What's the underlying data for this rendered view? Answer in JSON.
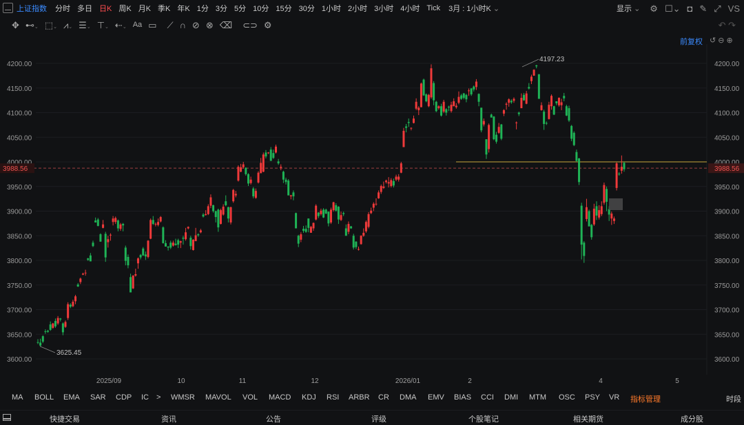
{
  "index_name": "上证指数",
  "periods": [
    "分时",
    "多日",
    "日K",
    "周K",
    "月K",
    "季K",
    "年K",
    "1分",
    "3分",
    "5分",
    "10分",
    "15分",
    "30分",
    "1小时",
    "2小时",
    "3小时",
    "4小时",
    "Tick"
  ],
  "active_period": "日K",
  "custom_period": "3月 : 1小时K",
  "display_menu": "显示",
  "vs_label": "VS",
  "adjust_label": "前复权",
  "toolbar_icons": [
    "move-icon",
    "line-tool-icon",
    "rect-tool-icon",
    "pattern-tool-icon",
    "fibonacci-tool-icon",
    "vertical-line-icon",
    "arrow-tool-icon",
    "text-tool-icon",
    "comment-tool-icon",
    "brush-icon",
    "magnet-icon",
    "hide-drawings-icon",
    "trash-icon",
    "link-icon",
    "settings-icon"
  ],
  "colors": {
    "up": "#ef3a3a",
    "down": "#1fb356",
    "accent": "#3b8bff",
    "highlight": "#ff7a2a",
    "hline": "#c8a83b",
    "price_tag": "#ef5350"
  },
  "chart_data": {
    "type": "candlestick",
    "title": "",
    "xlabel": "",
    "ylabel": "",
    "ylim": [
      3570,
      4240
    ],
    "y_ticks": [
      "4200.00",
      "4150.00",
      "4100.00",
      "4050.00",
      "4000.00",
      "3950.00",
      "3900.00",
      "3850.00",
      "3800.00",
      "3750.00",
      "3700.00",
      "3650.00",
      "3600.00"
    ],
    "x_ticks": [
      "2025/09",
      "10",
      "11",
      "12",
      "2026/01",
      "2",
      "3",
      "4",
      "5"
    ],
    "current_price": "3988.56",
    "horizontal_line": 4000,
    "annotations": [
      {
        "label": "4197.23",
        "type": "high"
      },
      {
        "label": "3625.45",
        "type": "low"
      }
    ],
    "candles": [
      [
        3634,
        3633,
        3630,
        3640
      ],
      [
        3633,
        3627,
        3625,
        3641
      ],
      [
        3646,
        3635,
        3632,
        3648
      ],
      [
        3656,
        3655,
        3651,
        3660
      ],
      [
        3657,
        3655,
        3653,
        3659
      ],
      [
        3670,
        3659,
        3657,
        3676
      ],
      [
        3663,
        3672,
        3661,
        3673
      ],
      [
        3677,
        3666,
        3663,
        3682
      ],
      [
        3672,
        3683,
        3669,
        3687
      ],
      [
        3682,
        3680,
        3676,
        3683
      ],
      [
        3672,
        3654,
        3648,
        3674
      ],
      [
        3665,
        3675,
        3663,
        3678
      ],
      [
        3683,
        3711,
        3679,
        3715
      ],
      [
        3710,
        3706,
        3703,
        3713
      ],
      [
        3707,
        3716,
        3705,
        3720
      ],
      [
        3717,
        3727,
        3711,
        3730
      ],
      [
        3751,
        3747,
        3746,
        3754
      ],
      [
        3756,
        3763,
        3752,
        3765
      ],
      [
        3771,
        3773,
        3770,
        3775
      ],
      [
        3774,
        3775,
        3769,
        3781
      ],
      [
        3804,
        3801,
        3799,
        3805
      ],
      [
        3810,
        3798,
        3798,
        3815
      ],
      [
        3836,
        3829,
        3827,
        3840
      ],
      [
        3881,
        3877,
        3877,
        3887
      ],
      [
        3883,
        3870,
        3869,
        3886
      ],
      [
        3853,
        3838,
        3838,
        3855
      ],
      [
        3866,
        3873,
        3865,
        3882
      ],
      [
        3854,
        3806,
        3797,
        3858
      ],
      [
        3837,
        3843,
        3826,
        3850
      ],
      [
        3852,
        3852,
        3840,
        3855
      ],
      [
        3878,
        3885,
        3871,
        3890
      ],
      [
        3878,
        3886,
        3874,
        3889
      ],
      [
        3881,
        3865,
        3859,
        3883
      ],
      [
        3864,
        3873,
        3860,
        3876
      ],
      [
        3874,
        3871,
        3859,
        3876
      ],
      [
        3826,
        3799,
        3790,
        3830
      ],
      [
        3807,
        3790,
        3784,
        3812
      ],
      [
        3766,
        3735,
        3735,
        3773
      ],
      [
        3743,
        3769,
        3742,
        3770
      ],
      [
        3769,
        3772,
        3767,
        3783
      ],
      [
        3794,
        3804,
        3783,
        3806
      ],
      [
        3811,
        3806,
        3802,
        3813
      ],
      [
        3824,
        3810,
        3809,
        3827
      ],
      [
        3812,
        3808,
        3801,
        3818
      ],
      [
        3807,
        3840,
        3804,
        3841
      ],
      [
        3844,
        3882,
        3843,
        3885
      ],
      [
        3882,
        3874,
        3872,
        3890
      ],
      [
        3874,
        3874,
        3869,
        3877
      ],
      [
        3872,
        3878,
        3869,
        3885
      ],
      [
        3879,
        3888,
        3877,
        3890
      ],
      [
        3867,
        3835,
        3834,
        3869
      ],
      [
        3835,
        3828,
        3828,
        3841
      ],
      [
        3828,
        3826,
        3820,
        3829
      ],
      [
        3836,
        3826,
        3823,
        3840
      ],
      [
        3830,
        3836,
        3828,
        3840
      ],
      [
        3834,
        3831,
        3830,
        3844
      ],
      [
        3841,
        3832,
        3825,
        3844
      ],
      [
        3836,
        3839,
        3825,
        3840
      ],
      [
        3846,
        3844,
        3832,
        3850
      ],
      [
        3843,
        3857,
        3840,
        3866
      ],
      [
        3865,
        3868,
        3863,
        3869
      ],
      [
        3846,
        3829,
        3822,
        3850
      ],
      [
        3821,
        3842,
        3820,
        3843
      ],
      [
        3839,
        3851,
        3839,
        3866
      ],
      [
        3853,
        3851,
        3848,
        3855
      ],
      [
        3857,
        3861,
        3855,
        3864
      ],
      [
        3893,
        3889,
        3887,
        3896
      ],
      [
        3892,
        3894,
        3891,
        3902
      ],
      [
        3894,
        3910,
        3892,
        3914
      ],
      [
        3911,
        3928,
        3906,
        3934
      ],
      [
        3912,
        3900,
        3897,
        3913
      ],
      [
        3900,
        3888,
        3877,
        3901
      ],
      [
        3903,
        3867,
        3858,
        3905
      ],
      [
        3874,
        3902,
        3873,
        3905
      ],
      [
        3893,
        3909,
        3891,
        3914
      ],
      [
        3920,
        3912,
        3910,
        3932
      ],
      [
        3908,
        3885,
        3877,
        3909
      ],
      [
        3877,
        3908,
        3873,
        3909
      ],
      [
        3920,
        3943,
        3917,
        3945
      ],
      [
        3932,
        3935,
        3928,
        3941
      ],
      [
        3962,
        3990,
        3960,
        3993
      ],
      [
        3980,
        3989,
        3979,
        3996
      ],
      [
        3989,
        3995,
        3986,
        4000
      ],
      [
        3988,
        3975,
        3972,
        3989
      ],
      [
        3975,
        3956,
        3951,
        3977
      ],
      [
        3957,
        3964,
        3954,
        3970
      ],
      [
        3946,
        3930,
        3926,
        3949
      ],
      [
        3927,
        3941,
        3925,
        3946
      ],
      [
        3958,
        3978,
        3956,
        3981
      ],
      [
        3977,
        3998,
        3977,
        4008
      ],
      [
        3980,
        4015,
        3979,
        4019
      ],
      [
        4019,
        4011,
        4007,
        4024
      ],
      [
        4019,
        4019,
        4016,
        4020
      ],
      [
        4025,
        4002,
        4002,
        4030
      ],
      [
        4018,
        4008,
        4006,
        4025
      ],
      [
        4019,
        4031,
        4017,
        4035
      ],
      [
        4001,
        3997,
        3994,
        4006
      ],
      [
        3988,
        3990,
        3983,
        3995
      ],
      [
        3980,
        3964,
        3957,
        3982
      ],
      [
        3964,
        3959,
        3954,
        3968
      ],
      [
        3962,
        3932,
        3932,
        3965
      ],
      [
        3930,
        3932,
        3924,
        3933
      ],
      [
        3938,
        3930,
        3922,
        3942
      ],
      [
        3896,
        3865,
        3865,
        3897
      ],
      [
        3850,
        3834,
        3827,
        3852
      ],
      [
        3842,
        3853,
        3837,
        3857
      ],
      [
        3864,
        3860,
        3856,
        3870
      ],
      [
        3864,
        3858,
        3856,
        3871
      ],
      [
        3885,
        3866,
        3857,
        3885
      ],
      [
        3856,
        3868,
        3857,
        3870
      ],
      [
        3865,
        3876,
        3860,
        3877
      ],
      [
        3883,
        3911,
        3881,
        3914
      ],
      [
        3897,
        3890,
        3886,
        3898
      ],
      [
        3894,
        3901,
        3891,
        3905
      ],
      [
        3903,
        3887,
        3886,
        3906
      ],
      [
        3903,
        3895,
        3894,
        3905
      ],
      [
        3899,
        3875,
        3869,
        3899
      ],
      [
        3877,
        3903,
        3874,
        3907
      ],
      [
        3902,
        3918,
        3899,
        3919
      ],
      [
        3912,
        3901,
        3899,
        3916
      ],
      [
        3909,
        3883,
        3874,
        3910
      ],
      [
        3882,
        3892,
        3880,
        3899
      ],
      [
        3896,
        3894,
        3890,
        3899
      ],
      [
        3865,
        3850,
        3850,
        3873
      ],
      [
        3858,
        3874,
        3853,
        3879
      ],
      [
        3869,
        3865,
        3864,
        3870
      ],
      [
        3850,
        3826,
        3822,
        3854
      ],
      [
        3838,
        3827,
        3823,
        3839
      ],
      [
        3822,
        3823,
        3820,
        3828
      ],
      [
        3833,
        3850,
        3832,
        3851
      ],
      [
        3850,
        3856,
        3848,
        3865
      ],
      [
        3859,
        3878,
        3856,
        3881
      ],
      [
        3868,
        3894,
        3865,
        3898
      ],
      [
        3896,
        3901,
        3894,
        3907
      ],
      [
        3907,
        3915,
        3900,
        3918
      ],
      [
        3915,
        3915,
        3911,
        3926
      ],
      [
        3926,
        3938,
        3925,
        3942
      ],
      [
        3939,
        3951,
        3935,
        3954
      ],
      [
        3947,
        3950,
        3945,
        3960
      ],
      [
        3959,
        3962,
        3956,
        3964
      ],
      [
        3956,
        3959,
        3948,
        3969
      ],
      [
        3951,
        3963,
        3948,
        3967
      ],
      [
        3961,
        3952,
        3948,
        3966
      ],
      [
        3964,
        3970,
        3961,
        3974
      ],
      [
        3964,
        3970,
        3960,
        3975
      ],
      [
        3978,
        3997,
        3977,
        4000
      ],
      [
        4030,
        4063,
        4030,
        4069
      ],
      [
        4072,
        4069,
        4060,
        4077
      ],
      [
        4081,
        4079,
        4071,
        4088
      ],
      [
        4069,
        4069,
        4064,
        4070
      ],
      [
        4079,
        4088,
        4078,
        4094
      ],
      [
        4108,
        4122,
        4105,
        4129
      ],
      [
        4105,
        4110,
        4095,
        4113
      ],
      [
        4111,
        4159,
        4111,
        4161
      ],
      [
        4167,
        4135,
        4134,
        4169
      ],
      [
        4137,
        4123,
        4121,
        4139
      ],
      [
        4113,
        4136,
        4111,
        4138
      ],
      [
        4131,
        4190,
        4128,
        4198
      ],
      [
        4160,
        4125,
        4115,
        4164
      ],
      [
        4122,
        4103,
        4101,
        4124
      ],
      [
        4109,
        4113,
        4106,
        4115
      ],
      [
        4113,
        4094,
        4092,
        4118
      ],
      [
        4102,
        4122,
        4099,
        4126
      ],
      [
        4107,
        4100,
        4094,
        4109
      ],
      [
        4112,
        4111,
        4103,
        4114
      ],
      [
        4103,
        4116,
        4100,
        4122
      ],
      [
        4113,
        4123,
        4113,
        4129
      ],
      [
        4111,
        4114,
        4108,
        4119
      ],
      [
        4120,
        4132,
        4117,
        4143
      ],
      [
        4135,
        4128,
        4126,
        4138
      ],
      [
        4139,
        4130,
        4127,
        4140
      ],
      [
        4136,
        4127,
        4121,
        4138
      ],
      [
        4144,
        4145,
        4134,
        4149
      ],
      [
        4149,
        4137,
        4134,
        4150
      ],
      [
        4153,
        4147,
        4143,
        4155
      ],
      [
        4152,
        4163,
        4146,
        4168
      ],
      [
        4138,
        4122,
        4113,
        4139
      ],
      [
        4110,
        4064,
        4060,
        4110
      ],
      [
        4076,
        4083,
        4072,
        4088
      ],
      [
        4046,
        4015,
        4006,
        4046
      ],
      [
        4026,
        4075,
        4019,
        4078
      ],
      [
        4096,
        4090,
        4090,
        4098
      ],
      [
        4092,
        4046,
        4044,
        4093
      ],
      [
        4055,
        4041,
        4037,
        4061
      ],
      [
        4059,
        4071,
        4057,
        4079
      ],
      [
        4076,
        4047,
        4044,
        4077
      ],
      [
        4098,
        4105,
        4093,
        4107
      ],
      [
        4116,
        4118,
        4106,
        4121
      ],
      [
        4120,
        4127,
        4112,
        4129
      ],
      [
        4124,
        4121,
        4118,
        4127
      ],
      [
        4124,
        4128,
        4120,
        4131
      ],
      [
        4079,
        4080,
        4066,
        4082
      ],
      [
        4100,
        4097,
        4093,
        4102
      ],
      [
        4109,
        4130,
        4109,
        4139
      ],
      [
        4136,
        4125,
        4124,
        4140
      ],
      [
        4118,
        4139,
        4117,
        4144
      ],
      [
        4152,
        4149,
        4147,
        4160
      ],
      [
        4164,
        4173,
        4158,
        4177
      ],
      [
        4175,
        4187,
        4175,
        4188
      ],
      [
        4196,
        4194,
        4190,
        4197
      ],
      [
        4178,
        4128,
        4128,
        4178
      ],
      [
        4105,
        4115,
        4104,
        4121
      ],
      [
        4102,
        4077,
        4065,
        4106
      ],
      [
        4079,
        4078,
        4075,
        4082
      ],
      [
        4087,
        4116,
        4086,
        4122
      ],
      [
        4113,
        4134,
        4106,
        4137
      ],
      [
        4113,
        4096,
        4095,
        4114
      ],
      [
        4123,
        4119,
        4115,
        4123
      ],
      [
        4115,
        4130,
        4112,
        4131
      ],
      [
        4115,
        4121,
        4105,
        4128
      ],
      [
        4134,
        4129,
        4123,
        4140
      ],
      [
        4113,
        4094,
        4093,
        4116
      ],
      [
        4109,
        4084,
        4081,
        4114
      ],
      [
        4073,
        4047,
        4042,
        4075
      ],
      [
        4059,
        4034,
        4032,
        4062
      ],
      [
        4020,
        4002,
        4000,
        4025
      ],
      [
        4007,
        3959,
        3953,
        4008
      ],
      [
        3911,
        3832,
        3802,
        3917
      ],
      [
        3836,
        3809,
        3795,
        3839
      ],
      [
        3884,
        3908,
        3879,
        3925
      ],
      [
        3900,
        3869,
        3869,
        3903
      ],
      [
        3872,
        3847,
        3842,
        3874
      ],
      [
        3873,
        3905,
        3870,
        3915
      ],
      [
        3910,
        3891,
        3882,
        3920
      ],
      [
        3887,
        3902,
        3883,
        3912
      ],
      [
        3894,
        3910,
        3890,
        3920
      ],
      [
        3917,
        3953,
        3913,
        3958
      ],
      [
        3945,
        3919,
        3900,
        3950
      ],
      [
        3904,
        3893,
        3880,
        3910
      ],
      [
        3885,
        3895,
        3872,
        3899
      ],
      [
        3880,
        3885,
        3874,
        3889
      ],
      [
        3947,
        3997,
        3942,
        3999
      ],
      [
        3976,
        3975,
        3972,
        3979
      ],
      [
        3982,
        3990,
        3976,
        4013
      ],
      [
        3998,
        3985,
        3980,
        4000
      ]
    ]
  },
  "indicators": [
    "MA",
    "BOLL",
    "EMA",
    "SAR",
    "CDP",
    "IC",
    ">",
    "WMSR",
    "MAVOL",
    "VOL",
    "MACD",
    "KDJ",
    "RSI",
    "ARBR",
    "CR",
    "DMA",
    "EMV",
    "BIAS",
    "CCI",
    "DMI",
    "MTM",
    "OSC",
    "PSY",
    "VR",
    "指标管理"
  ],
  "timeframe_share": "时段",
  "bottom_tabs": [
    "快捷交易",
    "资讯",
    "公告",
    "评级",
    "个股笔记",
    "相关期货",
    "成分股"
  ]
}
